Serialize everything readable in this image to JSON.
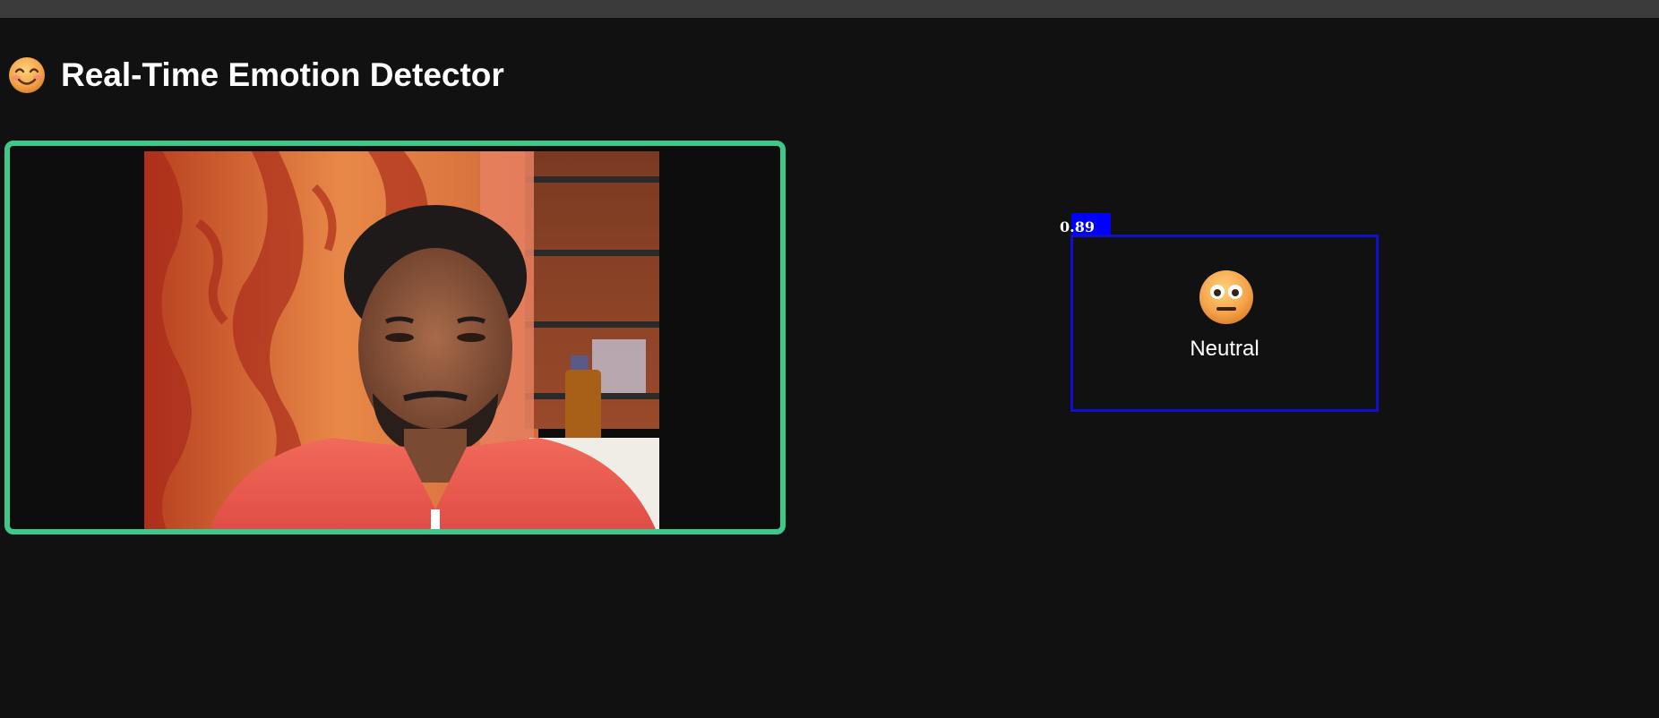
{
  "header": {
    "title": "Real-Time Emotion Detector",
    "icon": "smiling-face-icon"
  },
  "video": {
    "frame_border_color": "#3cc98a",
    "feed": "webcam-feed"
  },
  "detection": {
    "score": "0.89",
    "emotion": "Neutral",
    "emotion_icon": "neutral-face-icon",
    "box_color": "#1010cc",
    "score_bg_color": "#0000ff"
  }
}
